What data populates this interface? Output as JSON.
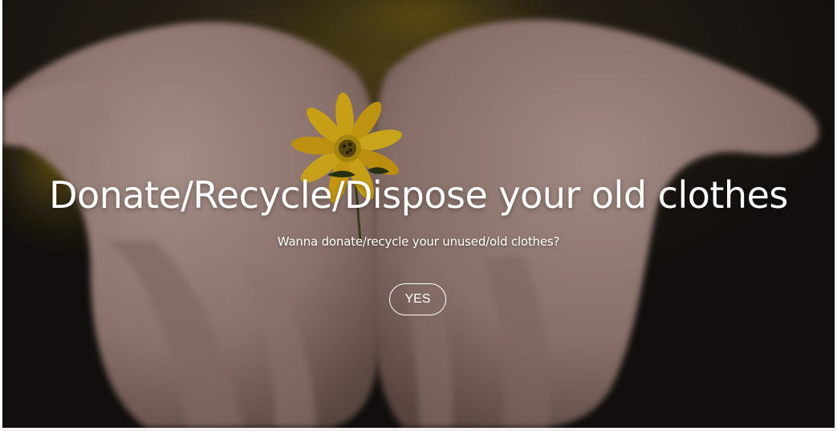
{
  "hero": {
    "title": "Donate/Recycle/Dispose your old clothes",
    "subtitle": "Wanna donate/recycle your unused/old clothes?",
    "cta_label": "YES",
    "background_image": "hands-holding-yellow-flower",
    "colors": {
      "text": "#ffffff",
      "flower": "#f2c21b",
      "skin": "#b89a90",
      "background": "#1a1614"
    }
  }
}
